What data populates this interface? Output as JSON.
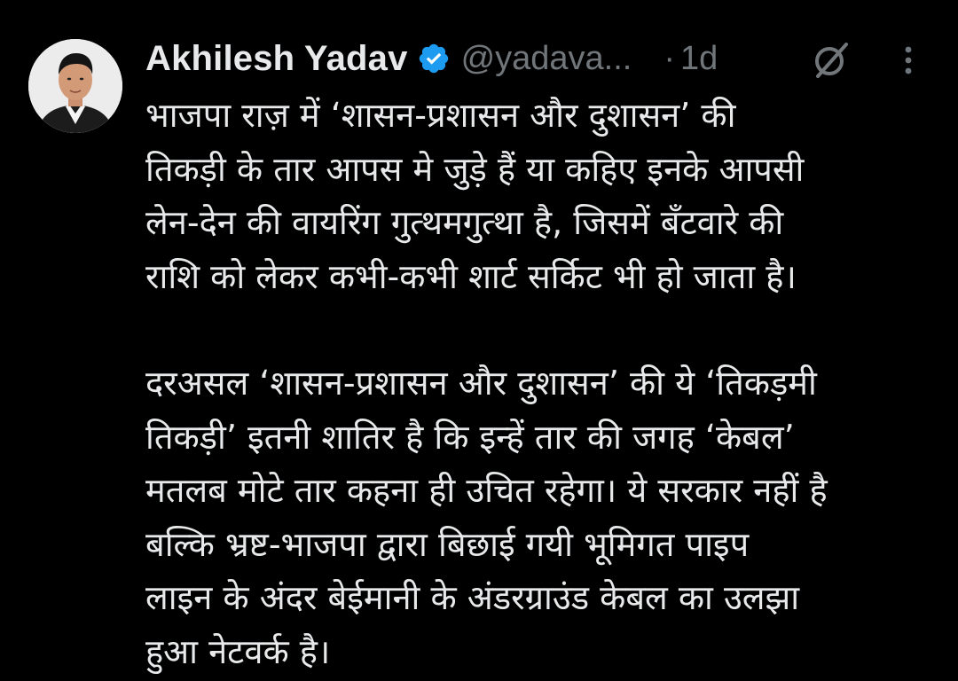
{
  "tweet": {
    "author_name": "Akhilesh Yadav",
    "handle": "@yadava...",
    "separator": "·",
    "time": "1d",
    "verified_icon": "verified-badge-icon",
    "grok_icon": "grok-slash-icon",
    "more_icon": "more-vertical-icon",
    "colors": {
      "background": "#000000",
      "text": "#e7e9ea",
      "secondary": "#71767b",
      "verified": "#1d9bf0"
    },
    "paragraphs": [
      {
        "lines": [
          "भाजपा राज़ में ‘शासन-प्रशासन और दुशासन’ की",
          "तिकड़ी के तार आपस मे जुड़े हैं या कहिए इनके आपसी",
          "लेन-देन की वायरिंग गुत्थमगुत्था है, जिसमें बँटवारे की",
          "राशि को लेकर कभी-कभी शार्ट सर्किट भी हो जाता है।"
        ]
      },
      {
        "lines": [
          "दरअसल ‘शासन-प्रशासन और दुशासन’ की ये ‘तिकड़मी",
          "तिकड़ी’ इतनी शातिर है कि इन्हें तार की जगह ‘केबल’",
          "मतलब मोटे तार कहना ही उचित रहेगा। ये सरकार नहीं है",
          "बल्कि भ्रष्ट-भाजपा द्वारा बिछाई गयी भूमिगत पाइप",
          "लाइन के अंदर बेईमानी के अंडरग्राउंड केबल का उलझा",
          "हुआ नेटवर्क है।"
        ]
      }
    ]
  }
}
